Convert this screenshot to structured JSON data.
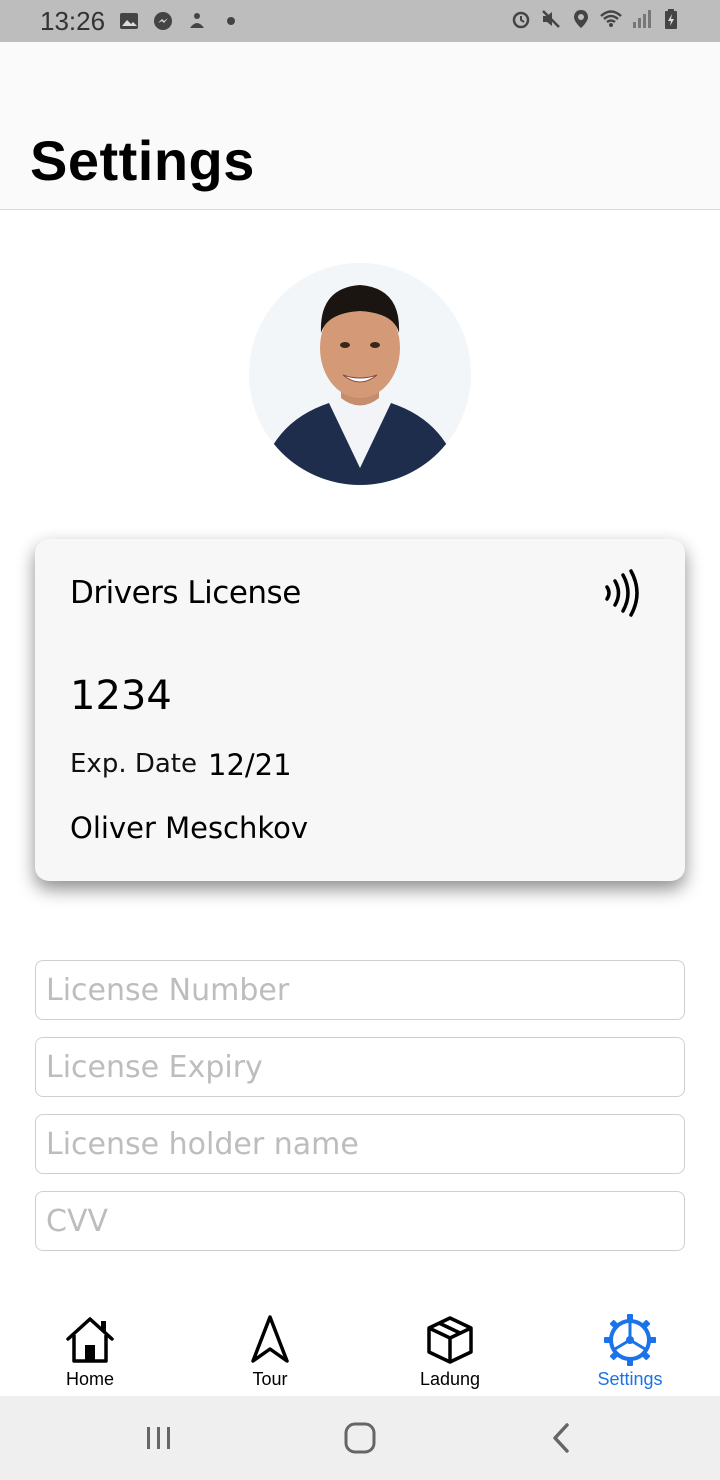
{
  "status_bar": {
    "time": "13:26",
    "left_icons": [
      "gallery-icon",
      "messenger-icon",
      "app-icon",
      "dot-icon"
    ],
    "right_icons": [
      "alarm-icon",
      "mute-icon",
      "location-icon",
      "wifi-icon",
      "signal-icon",
      "battery-icon"
    ]
  },
  "header": {
    "title": "Settings"
  },
  "profile": {
    "avatar": "avatar"
  },
  "license_card": {
    "title": "Drivers License",
    "number": "1234",
    "exp_label": "Exp. Date",
    "exp_value": "12/21",
    "holder": "Oliver Meschkov",
    "icon": "nfc-icon"
  },
  "form": {
    "license_number": {
      "value": "",
      "placeholder": "License Number"
    },
    "license_expiry": {
      "value": "",
      "placeholder": "License Expiry"
    },
    "license_holder": {
      "value": "",
      "placeholder": "License holder name"
    },
    "cvv": {
      "value": "",
      "placeholder": "CVV"
    }
  },
  "tabs": [
    {
      "label": "Home",
      "icon": "home-icon"
    },
    {
      "label": "Tour",
      "icon": "navigation-icon"
    },
    {
      "label": "Ladung",
      "icon": "package-icon"
    },
    {
      "label": "Settings",
      "icon": "gear-icon",
      "active": true
    }
  ],
  "colors": {
    "accent": "#1a73e8",
    "status_bar": "#bdbdbd",
    "card": "#f7f7f7"
  },
  "system_nav": [
    "recent-apps-icon",
    "home-circle-icon",
    "back-icon"
  ]
}
